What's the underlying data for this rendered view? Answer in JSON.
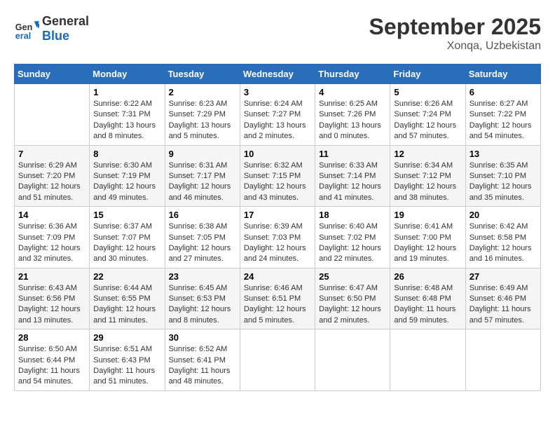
{
  "header": {
    "logo_line1": "General",
    "logo_line2": "Blue",
    "month": "September 2025",
    "location": "Xonqa, Uzbekistan"
  },
  "weekdays": [
    "Sunday",
    "Monday",
    "Tuesday",
    "Wednesday",
    "Thursday",
    "Friday",
    "Saturday"
  ],
  "weeks": [
    [
      {
        "day": "",
        "info": ""
      },
      {
        "day": "1",
        "info": "Sunrise: 6:22 AM\nSunset: 7:31 PM\nDaylight: 13 hours\nand 8 minutes."
      },
      {
        "day": "2",
        "info": "Sunrise: 6:23 AM\nSunset: 7:29 PM\nDaylight: 13 hours\nand 5 minutes."
      },
      {
        "day": "3",
        "info": "Sunrise: 6:24 AM\nSunset: 7:27 PM\nDaylight: 13 hours\nand 2 minutes."
      },
      {
        "day": "4",
        "info": "Sunrise: 6:25 AM\nSunset: 7:26 PM\nDaylight: 13 hours\nand 0 minutes."
      },
      {
        "day": "5",
        "info": "Sunrise: 6:26 AM\nSunset: 7:24 PM\nDaylight: 12 hours\nand 57 minutes."
      },
      {
        "day": "6",
        "info": "Sunrise: 6:27 AM\nSunset: 7:22 PM\nDaylight: 12 hours\nand 54 minutes."
      }
    ],
    [
      {
        "day": "7",
        "info": "Sunrise: 6:29 AM\nSunset: 7:20 PM\nDaylight: 12 hours\nand 51 minutes."
      },
      {
        "day": "8",
        "info": "Sunrise: 6:30 AM\nSunset: 7:19 PM\nDaylight: 12 hours\nand 49 minutes."
      },
      {
        "day": "9",
        "info": "Sunrise: 6:31 AM\nSunset: 7:17 PM\nDaylight: 12 hours\nand 46 minutes."
      },
      {
        "day": "10",
        "info": "Sunrise: 6:32 AM\nSunset: 7:15 PM\nDaylight: 12 hours\nand 43 minutes."
      },
      {
        "day": "11",
        "info": "Sunrise: 6:33 AM\nSunset: 7:14 PM\nDaylight: 12 hours\nand 41 minutes."
      },
      {
        "day": "12",
        "info": "Sunrise: 6:34 AM\nSunset: 7:12 PM\nDaylight: 12 hours\nand 38 minutes."
      },
      {
        "day": "13",
        "info": "Sunrise: 6:35 AM\nSunset: 7:10 PM\nDaylight: 12 hours\nand 35 minutes."
      }
    ],
    [
      {
        "day": "14",
        "info": "Sunrise: 6:36 AM\nSunset: 7:09 PM\nDaylight: 12 hours\nand 32 minutes."
      },
      {
        "day": "15",
        "info": "Sunrise: 6:37 AM\nSunset: 7:07 PM\nDaylight: 12 hours\nand 30 minutes."
      },
      {
        "day": "16",
        "info": "Sunrise: 6:38 AM\nSunset: 7:05 PM\nDaylight: 12 hours\nand 27 minutes."
      },
      {
        "day": "17",
        "info": "Sunrise: 6:39 AM\nSunset: 7:03 PM\nDaylight: 12 hours\nand 24 minutes."
      },
      {
        "day": "18",
        "info": "Sunrise: 6:40 AM\nSunset: 7:02 PM\nDaylight: 12 hours\nand 22 minutes."
      },
      {
        "day": "19",
        "info": "Sunrise: 6:41 AM\nSunset: 7:00 PM\nDaylight: 12 hours\nand 19 minutes."
      },
      {
        "day": "20",
        "info": "Sunrise: 6:42 AM\nSunset: 6:58 PM\nDaylight: 12 hours\nand 16 minutes."
      }
    ],
    [
      {
        "day": "21",
        "info": "Sunrise: 6:43 AM\nSunset: 6:56 PM\nDaylight: 12 hours\nand 13 minutes."
      },
      {
        "day": "22",
        "info": "Sunrise: 6:44 AM\nSunset: 6:55 PM\nDaylight: 12 hours\nand 11 minutes."
      },
      {
        "day": "23",
        "info": "Sunrise: 6:45 AM\nSunset: 6:53 PM\nDaylight: 12 hours\nand 8 minutes."
      },
      {
        "day": "24",
        "info": "Sunrise: 6:46 AM\nSunset: 6:51 PM\nDaylight: 12 hours\nand 5 minutes."
      },
      {
        "day": "25",
        "info": "Sunrise: 6:47 AM\nSunset: 6:50 PM\nDaylight: 12 hours\nand 2 minutes."
      },
      {
        "day": "26",
        "info": "Sunrise: 6:48 AM\nSunset: 6:48 PM\nDaylight: 11 hours\nand 59 minutes."
      },
      {
        "day": "27",
        "info": "Sunrise: 6:49 AM\nSunset: 6:46 PM\nDaylight: 11 hours\nand 57 minutes."
      }
    ],
    [
      {
        "day": "28",
        "info": "Sunrise: 6:50 AM\nSunset: 6:44 PM\nDaylight: 11 hours\nand 54 minutes."
      },
      {
        "day": "29",
        "info": "Sunrise: 6:51 AM\nSunset: 6:43 PM\nDaylight: 11 hours\nand 51 minutes."
      },
      {
        "day": "30",
        "info": "Sunrise: 6:52 AM\nSunset: 6:41 PM\nDaylight: 11 hours\nand 48 minutes."
      },
      {
        "day": "",
        "info": ""
      },
      {
        "day": "",
        "info": ""
      },
      {
        "day": "",
        "info": ""
      },
      {
        "day": "",
        "info": ""
      }
    ]
  ]
}
